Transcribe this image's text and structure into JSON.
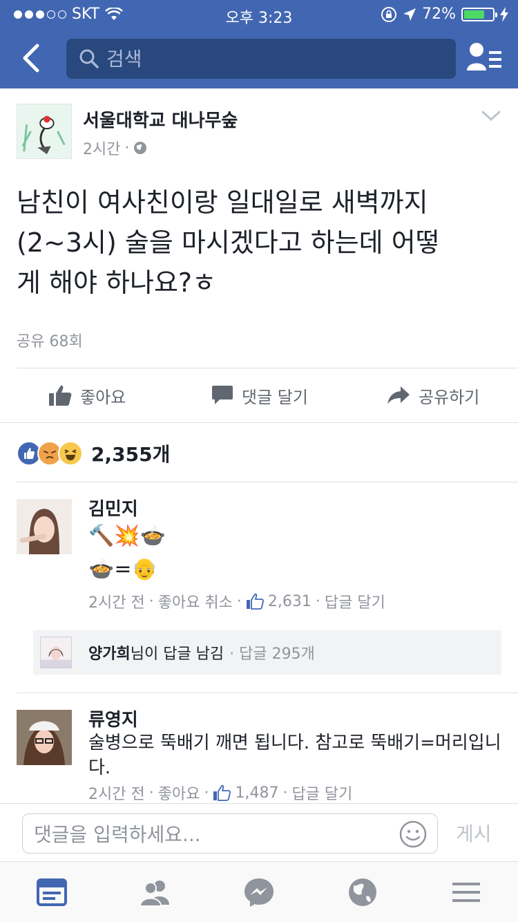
{
  "status_bar": {
    "carrier": "SKT",
    "time": "오후 3:23",
    "battery": "72%",
    "battery_level": 0.72
  },
  "nav": {
    "search_placeholder": "검색"
  },
  "post": {
    "page_name": "서울대학교 대나무숲",
    "time": "2시간",
    "separator": "·",
    "text_lines": [
      "남친이 여사친이랑 일대일로 새벽까지",
      "(2~3시) 술을 마시겠다고 하는데 어떻",
      "게 해야 하나요?ㅎ"
    ],
    "shares": "공유 68회"
  },
  "actions": {
    "like": "좋아요",
    "comment": "댓글 달기",
    "share": "공유하기"
  },
  "reactions": {
    "count": "2,355개"
  },
  "comments": [
    {
      "name": "김민지",
      "line1": "🔨💥🍲",
      "line2": "🍲=👴",
      "time": "2시간 전",
      "like_action": "좋아요 취소",
      "likes": "2,631",
      "reply": "답글 달기"
    },
    {
      "name": "류영지",
      "text": "술병으로 뚝배기 깨면 됩니다. 참고로 뚝배기=머리입니다.",
      "time": "2시간 전",
      "like_action": "좋아요",
      "likes": "1,487",
      "reply": "답글 달기"
    }
  ],
  "reply_summary": {
    "name": "양가희",
    "text": "님이 답글 남김",
    "count": "· 답글 295개"
  },
  "composer": {
    "placeholder": "댓글을 입력하세요...",
    "post_label": "게시"
  },
  "colors": {
    "brand": "#4267b2",
    "search_bg": "#29487d",
    "meta": "#90949c",
    "like_blue": "#4267b2"
  }
}
